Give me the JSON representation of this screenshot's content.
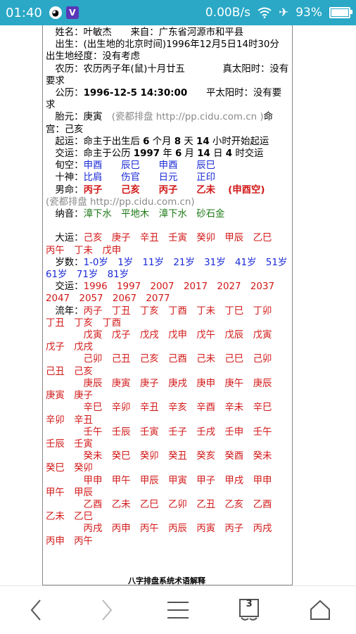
{
  "statusbar": {
    "time": "01:40",
    "net": "0.00B/s",
    "battery": "93%",
    "battery_level": 0.93
  },
  "lines": [
    {
      "segs": [
        {
          "t": "　姓名：叶敏杰　　来自：广东省河源市和平县"
        }
      ]
    },
    {
      "segs": [
        {
          "t": "　出生：(出生地的北京时间)1996年12月5日14时30分　　出生地经度：没有考虑"
        }
      ]
    },
    {
      "segs": [
        {
          "t": "　农历：农历丙子年(鼠)十月廿五　　　　真太阳时：没有要求"
        }
      ]
    },
    {
      "segs": [
        {
          "t": "　公历："
        },
        {
          "t": "1996-12-5 14:30:00",
          "c": "b"
        },
        {
          "t": "　　平太阳时：没有要求"
        }
      ]
    },
    {
      "segs": [
        {
          "t": "　胎元：庚寅　"
        },
        {
          "t": "(瓷都排盘 http://pp.cidu.com.cn )",
          "c": "gray"
        },
        {
          "t": "命宫：己亥"
        }
      ]
    },
    {
      "segs": [
        {
          "t": "　起运：命主于出生后 "
        },
        {
          "t": "6",
          "c": "b"
        },
        {
          "t": " 个月 "
        },
        {
          "t": "8",
          "c": "b"
        },
        {
          "t": " 天 "
        },
        {
          "t": "14",
          "c": "b"
        },
        {
          "t": " 小时开始起运"
        }
      ]
    },
    {
      "segs": [
        {
          "t": "　交运：命主于公历 "
        },
        {
          "t": "1997",
          "c": "b"
        },
        {
          "t": " 年 "
        },
        {
          "t": "6",
          "c": "b"
        },
        {
          "t": " 月 "
        },
        {
          "t": "14",
          "c": "b"
        },
        {
          "t": " 日 "
        },
        {
          "t": "4",
          "c": "b"
        },
        {
          "t": " 时交运"
        }
      ]
    },
    {
      "segs": [
        {
          "t": "　旬空："
        },
        {
          "t": "申酉　　辰巳　　申酉　　辰巳",
          "c": "blue"
        }
      ]
    },
    {
      "segs": [
        {
          "t": "　十神："
        },
        {
          "t": "比肩　　伤官　　日元　　正印",
          "c": "blue"
        }
      ]
    },
    {
      "segs": [
        {
          "t": "　男命："
        },
        {
          "t": "丙子　　己亥　　丙子　　乙未　 (申酉空)",
          "c": "red b"
        }
      ]
    },
    {
      "segs": [
        {
          "t": "(瓷都排盘 http://pp.cidu.com.cn)",
          "c": "gray"
        }
      ]
    },
    {
      "segs": [
        {
          "t": "　纳音："
        },
        {
          "t": "漳下水　平地木　漳下水　砂石金",
          "c": "green"
        }
      ]
    },
    {
      "segs": [
        {
          "t": " "
        }
      ]
    },
    {
      "segs": [
        {
          "t": "　大运："
        },
        {
          "t": "己亥　庚子　辛丑　壬寅　癸卯　甲辰　乙巳　丙午　丁未　戊申",
          "c": "red"
        }
      ]
    },
    {
      "segs": [
        {
          "t": "　岁数："
        },
        {
          "t": "1-0岁　1岁　11岁　21岁　31岁　41岁　51岁　61岁　71岁　81岁",
          "c": "blue"
        }
      ]
    },
    {
      "segs": [
        {
          "t": "　交运："
        },
        {
          "t": "1996　1997　2007　2017　2027　2037　2047　2057　2067　2077",
          "c": "red"
        }
      ]
    },
    {
      "segs": [
        {
          "t": "　流年："
        },
        {
          "t": "丙子　丁丑　丁亥　丁酉　丁未　丁巳　丁卯　丁丑　丁亥　丁酉",
          "c": "red"
        }
      ]
    },
    {
      "segs": [
        {
          "t": "　　　　戊寅　戊子　戊戌　戊申　戊午　戊辰　戊寅　戊子　戊戌",
          "c": "red"
        }
      ]
    },
    {
      "segs": [
        {
          "t": "　　　　己卯　己丑　己亥　己酉　己未　己巳　己卯　己丑　己亥",
          "c": "red"
        }
      ]
    },
    {
      "segs": [
        {
          "t": "　　　　庚辰　庚寅　庚子　庚戌　庚申　庚午　庚辰　庚寅　庚子",
          "c": "red"
        }
      ]
    },
    {
      "segs": [
        {
          "t": "　　　　辛巳　辛卯　辛丑　辛亥　辛酉　辛未　辛巳　辛卯　辛丑",
          "c": "red"
        }
      ]
    },
    {
      "segs": [
        {
          "t": "　　　　壬午　壬辰　壬寅　壬子　壬戌　壬申　壬午　壬辰　壬寅",
          "c": "red"
        }
      ]
    },
    {
      "segs": [
        {
          "t": "　　　　癸未　癸巳　癸卯　癸丑　癸亥　癸酉　癸未　癸巳　癸卯",
          "c": "red"
        }
      ]
    },
    {
      "segs": [
        {
          "t": "　　　　甲申　甲午　甲辰　甲寅　甲子　甲戌　甲申　甲午　甲辰",
          "c": "red"
        }
      ]
    },
    {
      "segs": [
        {
          "t": "　　　　乙酉　乙未　乙巳　乙卯　乙丑　乙亥　乙酉　乙未　乙巳",
          "c": "red"
        }
      ]
    },
    {
      "segs": [
        {
          "t": "　　　　丙戌　丙申　丙午　丙辰　丙寅　丙子　丙戌　丙申　丙午",
          "c": "red"
        }
      ]
    }
  ],
  "footer_label": "八字排盘系统术语解释",
  "nav": {
    "tab_count": "3"
  }
}
